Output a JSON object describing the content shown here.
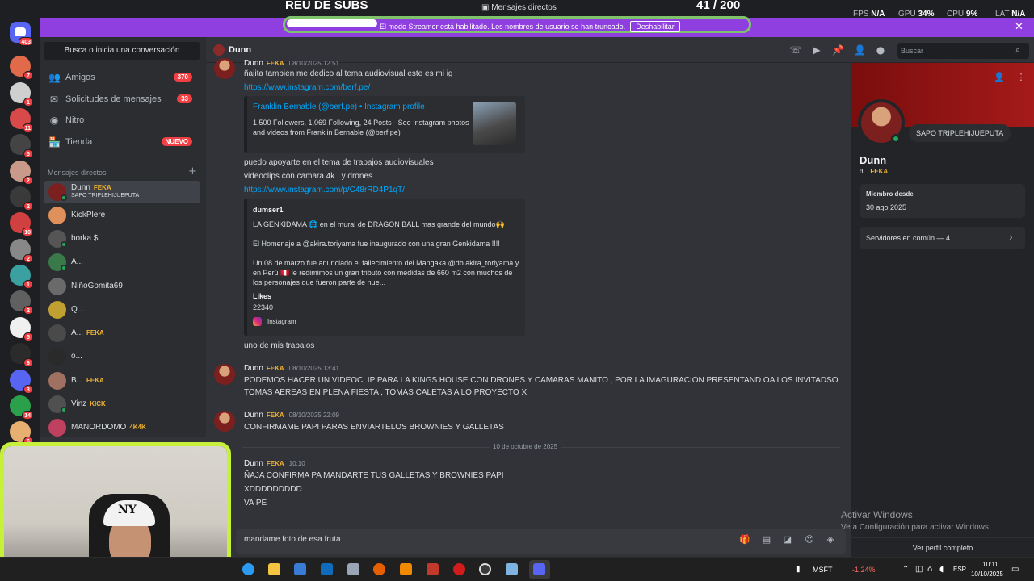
{
  "overlay": {
    "goal_title": "REU DE SUBS",
    "goal_progress": "41   / 200",
    "window_title": "Mensajes directos",
    "fps_label": "FPS",
    "fps_value": "N/A",
    "gpu_label": "GPU",
    "gpu_value": "34%",
    "cpu_label": "CPU",
    "cpu_value": "9%",
    "lat_label": "LAT",
    "lat_value": "N/A"
  },
  "banner": {
    "text": "El modo Streamer está habilitado. Los nombres de usuario se han truncado.",
    "button": "Deshabilitar",
    "color": "#8f3fe0"
  },
  "rail": {
    "home_badge": "403",
    "servers": [
      {
        "color": "#e06a4a",
        "badge": "7"
      },
      {
        "color": "#cfcfcf",
        "badge": "1"
      },
      {
        "color": "#d84a4a",
        "badge": "11"
      },
      {
        "color": "#444444",
        "badge": "5"
      },
      {
        "color": "#c99a8a",
        "badge": "2"
      },
      {
        "color": "#3a3a3a",
        "badge": "2"
      },
      {
        "color": "#d04040",
        "badge": "10"
      },
      {
        "color": "#888888",
        "badge": "2"
      },
      {
        "color": "#3aa0a0",
        "badge": "1"
      },
      {
        "color": "#606060",
        "badge": "2"
      },
      {
        "color": "#f0f0f0",
        "badge": "5"
      },
      {
        "color": "#2b2b2b",
        "badge": "6"
      },
      {
        "color": "#5865f2",
        "badge": "3"
      },
      {
        "color": "#2aa04a",
        "badge": "14"
      },
      {
        "color": "#e8b070",
        "badge": "6"
      }
    ]
  },
  "sidebar": {
    "search_placeholder": "Busca o inicia una conversación",
    "nav": [
      {
        "label": "Amigos",
        "count": "370"
      },
      {
        "label": "Solicitudes de mensajes",
        "count": "33"
      },
      {
        "label": "Nitro",
        "count": ""
      },
      {
        "label": "Tienda",
        "count": "NUEVO"
      }
    ],
    "dm_header": "Mensajes directos",
    "dms": [
      {
        "name": "Dunn",
        "tag": "FEKA",
        "sub": "SAPO TRIPLEHIJUEPUTA",
        "color": "#7b1f1f"
      },
      {
        "name": "KickPlere",
        "tag": "",
        "sub": "",
        "color": "#e0905a"
      },
      {
        "name": "borka $",
        "tag": "",
        "sub": "",
        "color": "#555555"
      },
      {
        "name": "A...",
        "tag": "",
        "sub": "",
        "color": "#3a7a4a"
      },
      {
        "name": "NiñoGomita69",
        "tag": "",
        "sub": "",
        "color": "#6a6a6a"
      },
      {
        "name": "Q...",
        "tag": "",
        "sub": "",
        "color": "#c0a030"
      },
      {
        "name": "A...",
        "tag": "FEKA",
        "sub": "",
        "color": "#4a4a4a"
      },
      {
        "name": "o...",
        "tag": "",
        "sub": "",
        "color": "#2a2a2a"
      },
      {
        "name": "B...",
        "tag": "FEKA",
        "sub": "",
        "color": "#a07060"
      },
      {
        "name": "Vinz",
        "tag": "KICK",
        "sub": "",
        "color": "#505050"
      },
      {
        "name": "MANORDOMO",
        "tag": "4K4K",
        "sub": "",
        "color": "#c04060"
      }
    ]
  },
  "chat": {
    "title": "Dunn",
    "search_placeholder": "Buscar",
    "messages": {
      "m1_author": "Dunn",
      "m1_tag": "FEKA",
      "m1_time": "08/10/2025 12:51",
      "m1_text": "ñajita tambien me dedico al tema audiovisual este es mi ig",
      "m1_link": "https://www.instagram.com/berf.pe/",
      "embed1_title": "Franklin Bernable (@berf.pe) • Instagram profile",
      "embed1_desc1": "1,500 Followers, 1,069 Following, 24 Posts - See Instagram photos",
      "embed1_desc2": "and videos from Franklin Bernable (@berf.pe)",
      "m1_text2": "puedo apoyarte en el tema de trabajos audiovisuales",
      "m1_text3": "videoclips con camara 4k , y drones",
      "m1_link2": "https://www.instagram.com/p/C48rRD4P1qT/",
      "embed2_author": "dumser1",
      "embed2_l1": "LA GENKIDAMA 🌐 en el mural de DRAGON BALL mas grande del mundo🙌",
      "embed2_l2": "El Homenaje a @akira.toriyama fue inaugurado con una gran Genkidama !!!!",
      "embed2_l3": "Un 08 de marzo fue anunciado el fallecimiento del Mangaka @db.akira_toriyama y",
      "embed2_l4": "en Perú 🇵🇪 le redimimos un gran tributo con medidas de 660 m2 con muchos de",
      "embed2_l5": "los personajes que fueron parte de nue...",
      "embed2_likes_lbl": "Likes",
      "embed2_likes": "22340",
      "embed2_footer": "Instagram",
      "m1_text4": "uno de mis trabajos",
      "m2_author": "Dunn",
      "m2_tag": "FEKA",
      "m2_time": "08/10/2025 13:41",
      "m2_l1": "PODEMOS HACER UN VIDEOCLIP PARA LA KINGS HOUSE CON DRONES Y CAMARAS MANITO , POR LA IMAGURACION PRESENTAND OA LOS INVITADSO",
      "m2_l2": "TOMAS AEREAS EN PLENA FIESTA , TOMAS CALETAS A LO PROYECTO X",
      "m3_author": "Dunn",
      "m3_tag": "FEKA",
      "m3_time": "08/10/2025 22:09",
      "m3_text": "CONFIRMAME PAPI PARAS ENVIARTELOS BROWNIES Y GALLETAS",
      "date_divider": "10 de octubre de 2025",
      "m4_author": "Dunn",
      "m4_tag": "FEKA",
      "m4_time": "10:10",
      "m4_l1": "ÑAJA CONFIRMA PA MANDARTE TUS GALLETAS Y BROWNIES PAPI",
      "m4_l2": "XDDDDDDDDD",
      "m4_l3": "VA PE"
    },
    "composer_value": "mandame foto de esa fruta"
  },
  "profile": {
    "status": "SAPO TRIPLEHIJUEPUTA",
    "name": "Dunn",
    "handle": "d...",
    "handle_tag": "FEKA",
    "member_since_label": "Miembro desde",
    "member_since": "30 ago 2025",
    "common_servers": "Servidores en común — 4",
    "view_full": "Ver perfil completo",
    "activate_title": "Activar Windows",
    "activate_sub": "Ve a Configuración para activar Windows."
  },
  "taskbar": {
    "stock_symbol": "MSFT",
    "stock_change": "-1.24%",
    "language": "ESP",
    "time": "10:11",
    "date": "10/10/2025"
  }
}
